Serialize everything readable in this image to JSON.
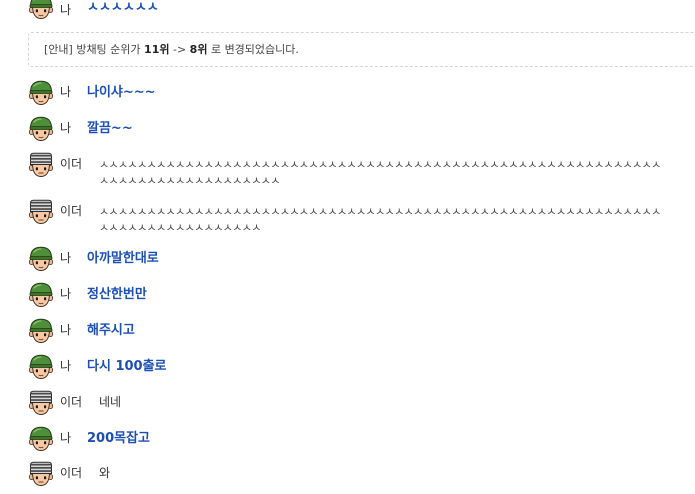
{
  "notice": {
    "prefix": "[안내] 방채팅 순위가 ",
    "from_rank": "11위",
    "arrow": " -> ",
    "to_rank": "8위",
    "suffix": " 로 변경되었습니다."
  },
  "messages": [
    {
      "sender": "나",
      "avatar": "green-helmet-soldier-icon",
      "text": "ㅅㅅㅅㅅㅅㅅ"
    },
    {
      "sender": "나",
      "avatar": "green-helmet-soldier-icon",
      "text": "나이샤~~~"
    },
    {
      "sender": "나",
      "avatar": "green-helmet-soldier-icon",
      "text": "깔끔~~"
    },
    {
      "sender": "이더",
      "avatar": "striped-helmet-soldier-icon",
      "line1": "ㅅㅅㅅㅅㅅㅅㅅㅅㅅㅅㅅㅅㅅㅅㅅㅅㅅㅅㅅㅅㅅㅅㅅㅅㅅㅅㅅㅅㅅㅅㅅㅅㅅㅅㅅㅅㅅㅅㅅㅅㅅㅅㅅㅅㅅㅅㅅㅅㅅㅅㅅㅅㅅㅅㅅㅅㅅㅅㅅ",
      "line2": "ㅅㅅㅅㅅㅅㅅㅅㅅㅅㅅㅅㅅㅅㅅㅅㅅㅅㅅㅅ"
    },
    {
      "sender": "이더",
      "avatar": "striped-helmet-soldier-icon",
      "line1": "ㅅㅅㅅㅅㅅㅅㅅㅅㅅㅅㅅㅅㅅㅅㅅㅅㅅㅅㅅㅅㅅㅅㅅㅅㅅㅅㅅㅅㅅㅅㅅㅅㅅㅅㅅㅅㅅㅅㅅㅅㅅㅅㅅㅅㅅㅅㅅㅅㅅㅅㅅㅅㅅㅅㅅㅅㅅㅅㅅ",
      "line2": "ㅅㅅㅅㅅㅅㅅㅅㅅㅅㅅㅅㅅㅅㅅㅅㅅㅅ"
    },
    {
      "sender": "나",
      "avatar": "green-helmet-soldier-icon",
      "text": "아까말한대로"
    },
    {
      "sender": "나",
      "avatar": "green-helmet-soldier-icon",
      "text": "정산한번만"
    },
    {
      "sender": "나",
      "avatar": "green-helmet-soldier-icon",
      "text": "해주시고"
    },
    {
      "sender": "나",
      "avatar": "green-helmet-soldier-icon",
      "text": "다시 100출로"
    },
    {
      "sender": "이더",
      "avatar": "striped-helmet-soldier-icon",
      "text": "네네"
    },
    {
      "sender": "나",
      "avatar": "green-helmet-soldier-icon",
      "text": "200목잡고"
    },
    {
      "sender": "이더",
      "avatar": "striped-helmet-soldier-icon",
      "text": "와"
    }
  ]
}
